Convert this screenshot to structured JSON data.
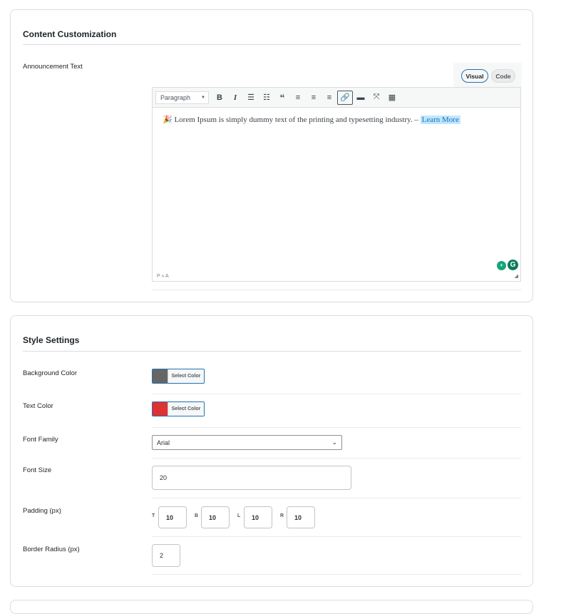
{
  "content_card": {
    "title": "Content Customization",
    "announcement_label": "Announcement Text",
    "tabs": {
      "visual": "Visual",
      "code": "Code"
    },
    "toolbar": {
      "format": "Paragraph"
    },
    "editor": {
      "emoji": "🎉",
      "text": "Lorem Ipsum is simply dummy text of the printing and typesetting industry. –",
      "link": "Learn More",
      "path": "P » A"
    }
  },
  "style_card": {
    "title": "Style Settings",
    "background_color": {
      "label": "Background Color",
      "button": "Select Color",
      "value": "#666666"
    },
    "text_color": {
      "label": "Text Color",
      "button": "Select Color",
      "value": "#dd3333"
    },
    "font_family": {
      "label": "Font Family",
      "value": "Arial"
    },
    "font_size": {
      "label": "Font Size",
      "value": "20"
    },
    "padding": {
      "label": "Padding (px)",
      "t_label": "T",
      "t": "10",
      "b_label": "B",
      "b": "10",
      "l_label": "L",
      "l": "10",
      "r_label": "R",
      "r": "10"
    },
    "border_radius": {
      "label": "Border Radius (px)",
      "value": "2"
    }
  }
}
